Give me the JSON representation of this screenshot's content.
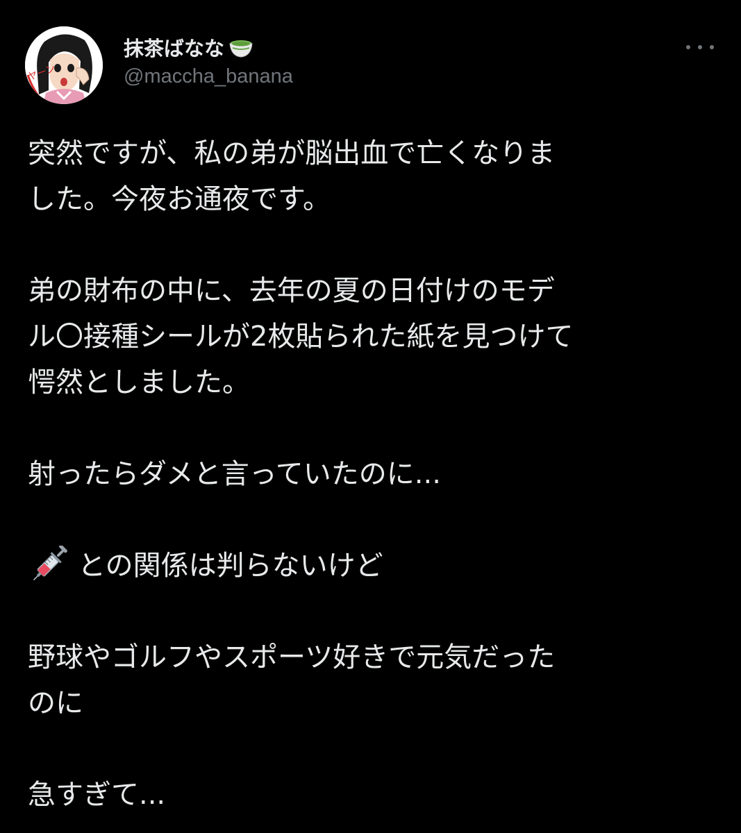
{
  "user": {
    "display_name": "抹茶ばなな",
    "name_emoji": "matcha-tea-emoji",
    "handle": "@maccha_banana",
    "avatar": "manga-girl-avatar",
    "avatar_text": "ヤーン"
  },
  "menu": {
    "icon": "more-horizontal-icon"
  },
  "tweet": {
    "paragraphs": [
      {
        "lines": [
          "突然ですが、私の弟が脳出血で亡くなりま",
          "した。今夜お通夜です。"
        ]
      },
      {
        "lines": [
          "弟の財布の中に、去年の夏の日付けのモデ",
          "ル〇接種シールが2枚貼られた紙を見つけて",
          "愕然としました。"
        ]
      },
      {
        "lines": [
          "射ったらダメと言っていたのに..."
        ]
      },
      {
        "icon": "syringe-emoji",
        "lines": [
          "との関係は判らないけど"
        ]
      },
      {
        "lines": [
          "野球やゴルフやスポーツ好きで元気だった",
          "のに"
        ]
      },
      {
        "lines": [
          "急すぎて..."
        ]
      }
    ]
  },
  "colors": {
    "background": "#000000",
    "text": "#e7e9ea",
    "secondary_text": "#71767b"
  }
}
